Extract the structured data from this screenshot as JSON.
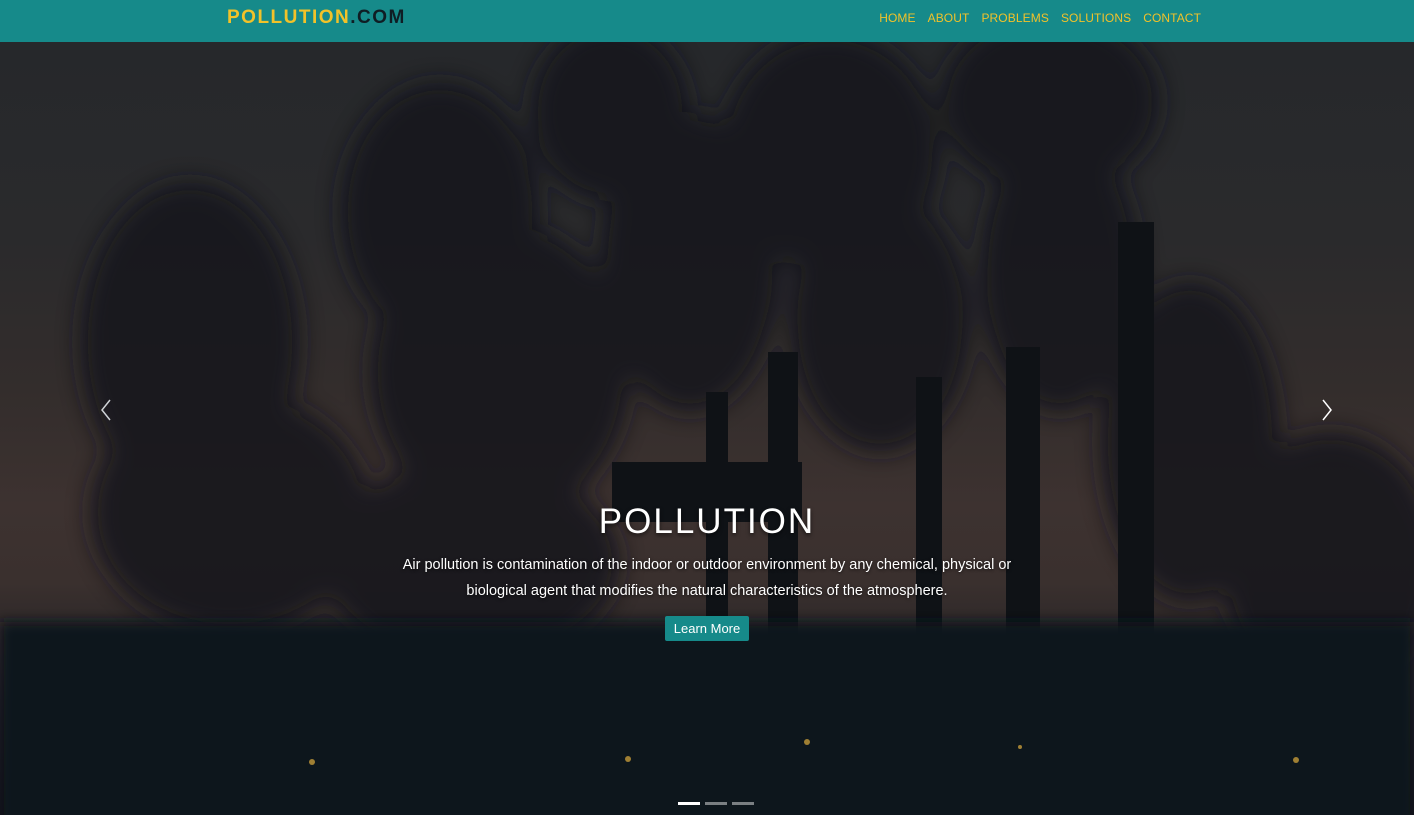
{
  "brand": {
    "name": "POLLUTION",
    "suffix": ".COM",
    "color": "#f2c229"
  },
  "nav": {
    "background": "#168a8a",
    "links": [
      "HOME",
      "ABOUT",
      "PROBLEMS",
      "SOLUTIONS",
      "CONTACT"
    ]
  },
  "hero": {
    "title": "POLLUTION",
    "text": "Air pollution is contamination of the indoor or outdoor environment by any chemical, physical or biological agent that modifies the natural characteristics of the atmosphere.",
    "button_label": "Learn More",
    "prev_icon": "chevron-left-icon",
    "next_icon": "chevron-right-icon",
    "slide_count": 3,
    "active_slide": 1
  }
}
